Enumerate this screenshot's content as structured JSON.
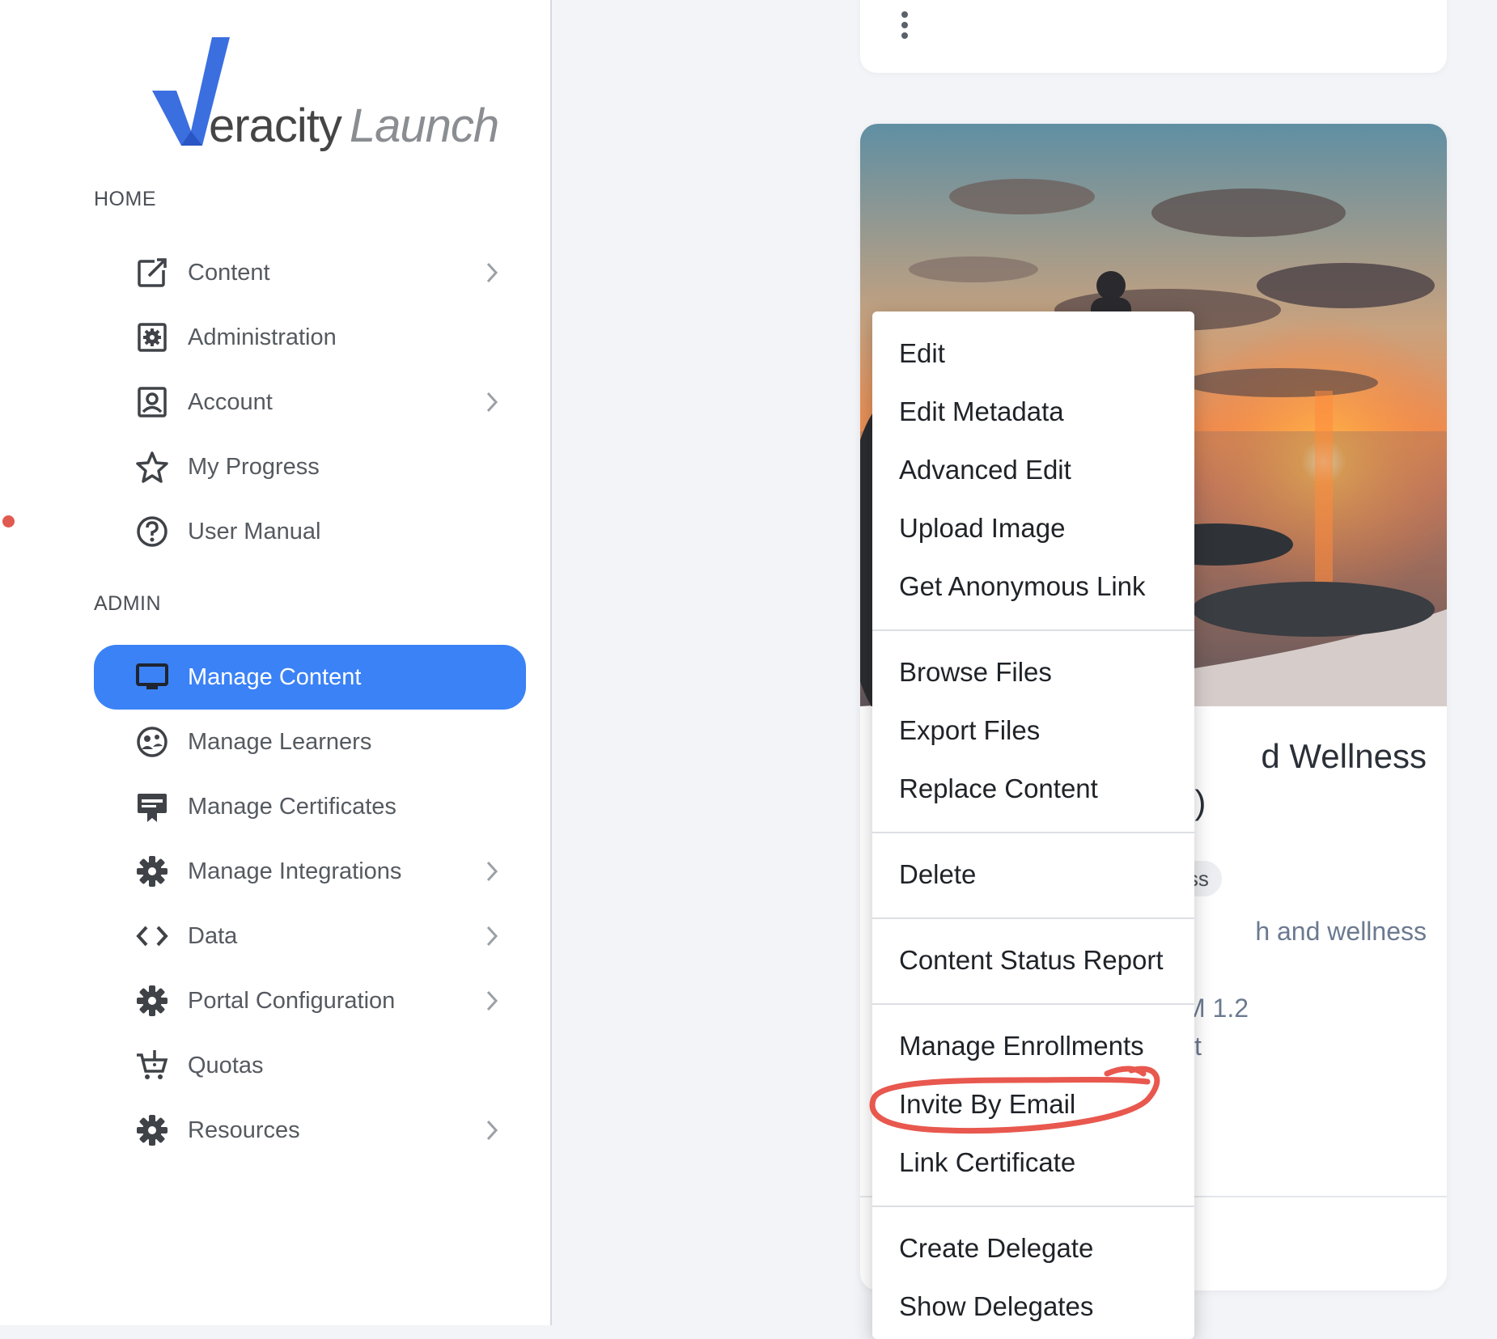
{
  "brand": {
    "logo_main": "eracity",
    "logo_sub": "Launch",
    "accent": "#3b82f6"
  },
  "sidebar": {
    "sections": [
      {
        "label": "HOME"
      },
      {
        "label": "ADMIN"
      }
    ],
    "home_items": [
      {
        "label": "Content",
        "icon": "external-edit-icon",
        "has_chevron": true
      },
      {
        "label": "Administration",
        "icon": "admin-gear-icon",
        "has_chevron": false
      },
      {
        "label": "Account",
        "icon": "account-icon",
        "has_chevron": true
      },
      {
        "label": "My Progress",
        "icon": "star-icon",
        "has_chevron": false
      },
      {
        "label": "User Manual",
        "icon": "help-icon",
        "has_chevron": false
      }
    ],
    "admin_items": [
      {
        "label": "Manage Content",
        "icon": "monitor-icon",
        "has_chevron": false,
        "active": true
      },
      {
        "label": "Manage Learners",
        "icon": "learners-icon",
        "has_chevron": false
      },
      {
        "label": "Manage Certificates",
        "icon": "certificate-icon",
        "has_chevron": false
      },
      {
        "label": "Manage Integrations",
        "icon": "gear-icon",
        "has_chevron": true
      },
      {
        "label": "Data",
        "icon": "code-icon",
        "has_chevron": true
      },
      {
        "label": "Portal Configuration",
        "icon": "gear-icon",
        "has_chevron": true
      },
      {
        "label": "Quotas",
        "icon": "cart-icon",
        "has_chevron": false
      },
      {
        "label": "Resources",
        "icon": "gear-icon",
        "has_chevron": true
      }
    ]
  },
  "card": {
    "title_line1": "d Wellness",
    "title_line2": "e)",
    "tag": "ness",
    "desc": "h and wellness",
    "meta1": "M 1.2",
    "meta2": "t"
  },
  "menu": {
    "groups": [
      [
        "Edit",
        "Edit Metadata",
        "Advanced Edit",
        "Upload Image",
        "Get Anonymous Link"
      ],
      [
        "Browse Files",
        "Export Files",
        "Replace Content"
      ],
      [
        "Delete"
      ],
      [
        "Content Status Report"
      ],
      [
        "Manage Enrollments",
        "Invite By Email",
        "Link Certificate"
      ],
      [
        "Create Delegate",
        "Show Delegates"
      ]
    ],
    "highlighted": "Invite By Email",
    "annotation_color": "#e8584e"
  }
}
